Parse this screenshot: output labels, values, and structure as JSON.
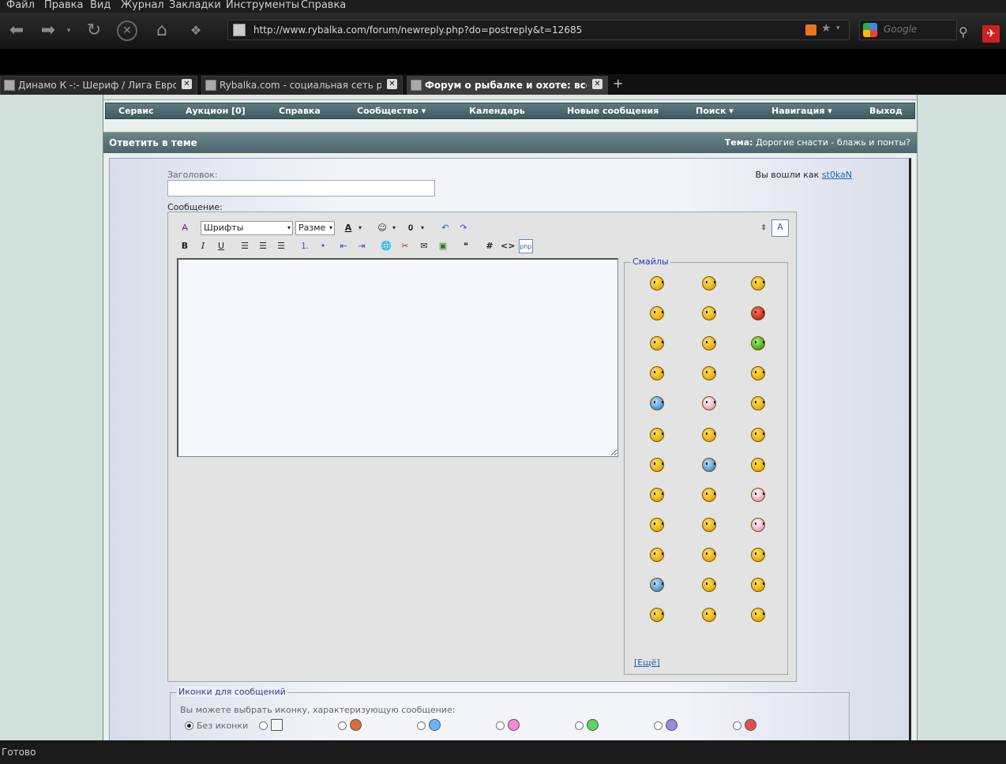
{
  "menu": [
    "Файл",
    "Правка",
    "Вид",
    "Журнал",
    "Закладки",
    "Инструменты",
    "Справка"
  ],
  "toolbar": {
    "url": "http://www.rybalka.com/forum/newreply.php?do=postreply&t=12685",
    "search_placeholder": "Google",
    "icons": [
      "back-icon",
      "forward-icon",
      "reload-icon",
      "stop-icon",
      "home-icon",
      "bookmark-icon"
    ]
  },
  "tabs": [
    {
      "title": "Динамо К -:- Шериф / Лига Европ...",
      "active": false
    },
    {
      "title": "Rybalka.com - социальная сеть ры...",
      "active": false
    },
    {
      "title": "Форум о рыбалке и охоте: все, ...",
      "active": true
    }
  ],
  "forum_nav": [
    "Сервис",
    "Аукцион [0]",
    "Справка",
    "Сообщество ▾",
    "Календарь",
    "Новые сообщения",
    "Поиск ▾",
    "Навигация ▾",
    "Выход"
  ],
  "panel": {
    "heading": "Ответить в теме",
    "topic_label": "Тема:",
    "topic_value": "Дорогие снасти - блажь и понты?"
  },
  "form": {
    "title_label": "Заголовок:",
    "title_value": "",
    "message_label": "Сообщение:",
    "logged_in_prefix": "Вы вошли как",
    "username": "st0kaN"
  },
  "editor": {
    "font_select": "Шрифты",
    "size_select": "Разме",
    "message_value": ""
  },
  "smilies": {
    "legend": "Смайлы",
    "more_link": "[Ещё]",
    "count": 36
  },
  "message_icons": {
    "legend": "Иконки для сообщений",
    "hint": "Вы можете выбрать иконку, характеризующую сообщение:",
    "no_icon_label": "Без иконки",
    "selected": "Без иконки"
  },
  "status": "Готово"
}
